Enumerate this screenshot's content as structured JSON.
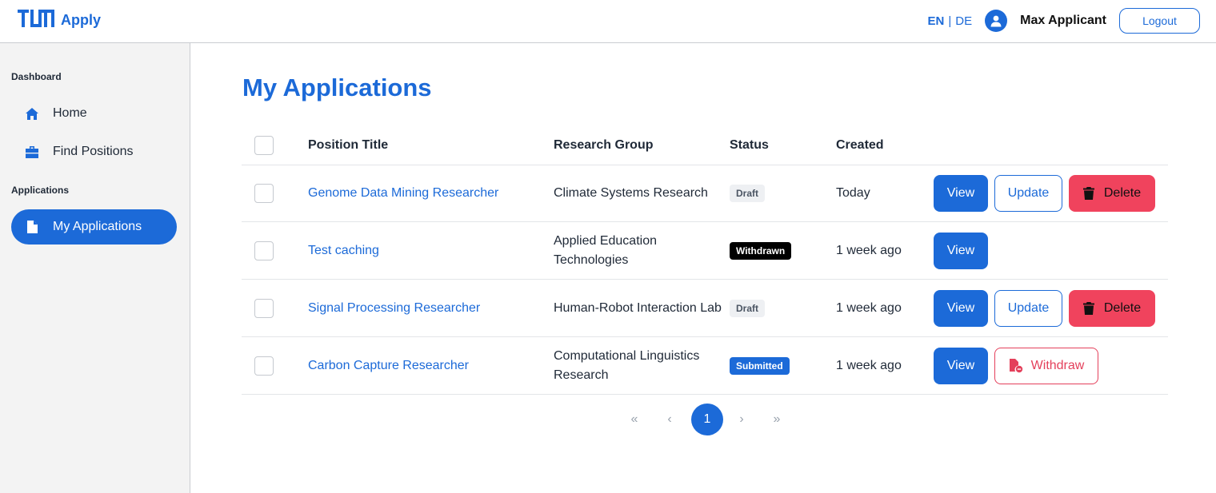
{
  "header": {
    "app_name": "Apply",
    "lang_active": "EN",
    "lang_separator": "|",
    "lang_other": "DE",
    "user_name": "Max Applicant",
    "logout_label": "Logout",
    "user_icon": "user-circle-icon",
    "logo": "tum-logo"
  },
  "sidebar": {
    "section_dashboard": "Dashboard",
    "section_applications": "Applications",
    "items": [
      {
        "label": "Home",
        "icon": "home-icon",
        "active": false
      },
      {
        "label": "Find Positions",
        "icon": "briefcase-icon",
        "active": false
      },
      {
        "label": "My Applications",
        "icon": "document-icon",
        "active": true
      }
    ]
  },
  "main": {
    "title": "My Applications",
    "table": {
      "headers": {
        "position_title": "Position Title",
        "research_group": "Research Group",
        "status": "Status",
        "created": "Created"
      },
      "rows": [
        {
          "title": "Genome Data Mining Researcher",
          "group": "Climate Systems Research",
          "status": "Draft",
          "created": "Today"
        },
        {
          "title": "Test caching",
          "group": "Applied Education Technologies",
          "status": "Withdrawn",
          "created": "1 week ago"
        },
        {
          "title": "Signal Processing Researcher",
          "group": "Human-Robot Interaction Lab",
          "status": "Draft",
          "created": "1 week ago"
        },
        {
          "title": "Carbon Capture Researcher",
          "group": "Computational Linguistics Research",
          "status": "Submitted",
          "created": "1 week ago"
        }
      ],
      "actions": {
        "view": "View",
        "update": "Update",
        "delete": "Delete",
        "withdraw": "Withdraw"
      }
    },
    "pagination": {
      "first": "«",
      "prev": "‹",
      "current": "1",
      "next": "›",
      "last": "»"
    }
  },
  "colors": {
    "primary": "#1c6ad8",
    "danger": "#f0435d",
    "badge_draft_bg": "#eef0f3",
    "badge_withdrawn_bg": "#000000",
    "badge_submitted_bg": "#1c6ad8"
  }
}
